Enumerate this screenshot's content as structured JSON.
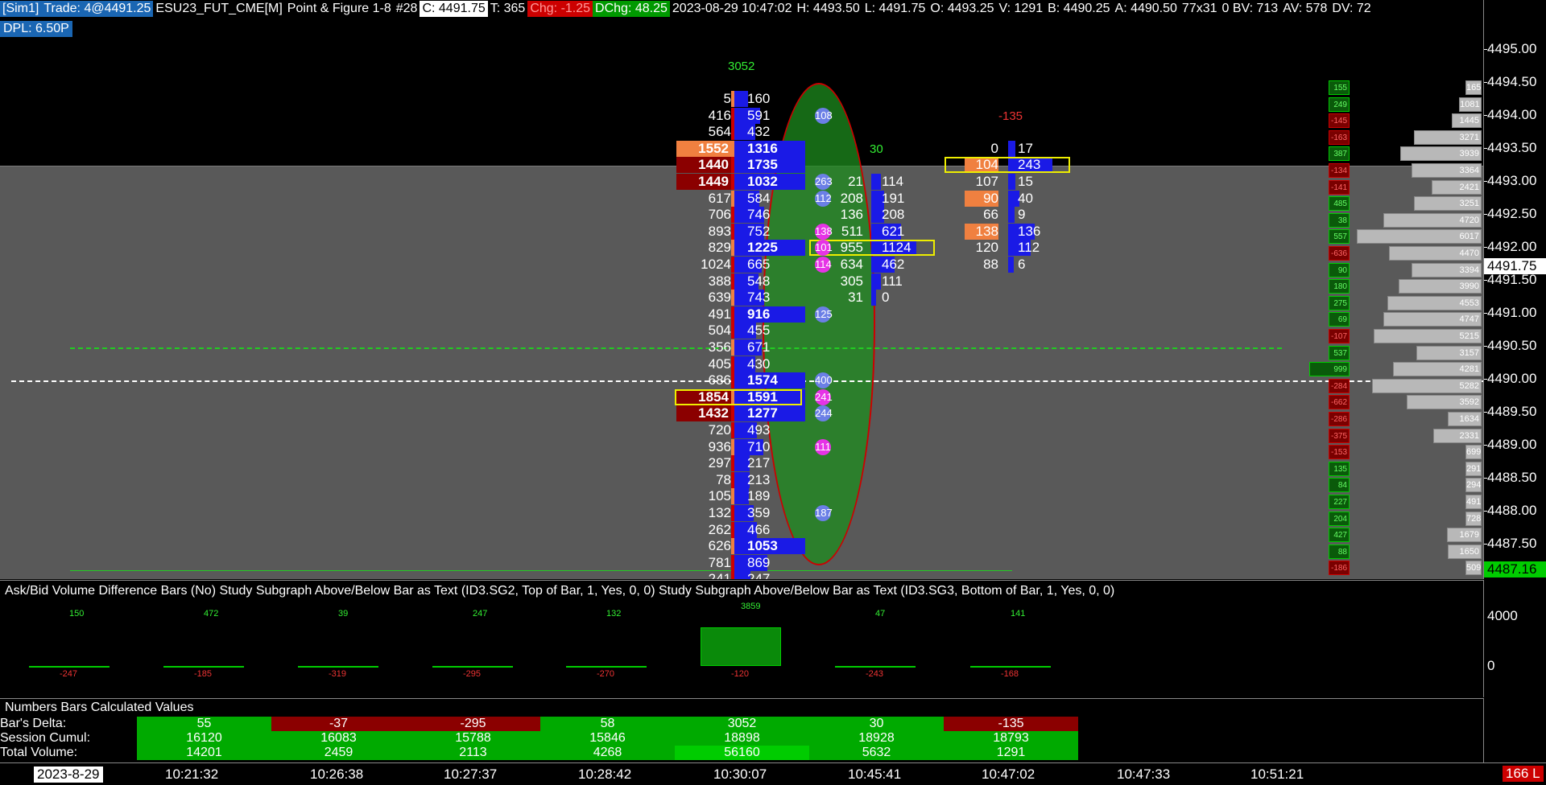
{
  "header": {
    "sim": "[Sim1]",
    "trade": "Trade: 4@4491.25",
    "symbol": "ESU23_FUT_CME[M]",
    "chart_type": "Point & Figure 1-8",
    "chart_num": "#28",
    "close": "C: 4491.75",
    "t": "T: 365",
    "chg": "Chg: -1.25",
    "dchg": "DChg: 48.25",
    "datetime": "2023-08-29 10:47:02",
    "high": "H: 4493.50",
    "low": "L: 4491.75",
    "open": "O: 4493.25",
    "vol": "V: 1291",
    "bid": "B: 4490.25",
    "ask": "A: 4490.50",
    "size": "77x31",
    "bv": "0 BV: 713",
    "av": "AV: 578",
    "dv": "DV: 72"
  },
  "dpl": "DPL: 6.50P",
  "price_axis": [
    "4495.00",
    "4494.50",
    "4494.00",
    "4493.50",
    "4493.00",
    "4492.50",
    "4492.00",
    "4491.50",
    "4491.00",
    "4490.50",
    "4490.00",
    "4489.50",
    "4489.00",
    "4488.50",
    "4488.00",
    "4487.50"
  ],
  "current_price": "4491.75",
  "ema_price": "4487.16",
  "bar_total_label": "3052",
  "bar2_label": "30",
  "bar3_label": "-135",
  "col1_bid": [
    "5",
    "416",
    "564",
    "1552",
    "1440",
    "1449",
    "617",
    "706",
    "893",
    "829",
    "1024",
    "388",
    "639",
    "491",
    "504",
    "356",
    "405",
    "686",
    "1854",
    "1432",
    "720",
    "936",
    "297",
    "78",
    "105",
    "132",
    "262",
    "626",
    "781",
    "241"
  ],
  "col1_ask": [
    "160",
    "591",
    "432",
    "1316",
    "1735",
    "1032",
    "584",
    "746",
    "752",
    "1225",
    "665",
    "548",
    "743",
    "916",
    "455",
    "671",
    "430",
    "1574",
    "1591",
    "1277",
    "493",
    "710",
    "217",
    "213",
    "189",
    "359",
    "466",
    "1053",
    "869",
    "247"
  ],
  "col2_bid": [
    "21",
    "208",
    "136",
    "511",
    "955",
    "634",
    "305",
    "31"
  ],
  "col2_ask": [
    "114",
    "191",
    "208",
    "621",
    "1124",
    "462",
    "111",
    "0"
  ],
  "col3_bid": [
    "0",
    "104",
    "107",
    "90",
    "66",
    "138",
    "120",
    "88"
  ],
  "col3_ask": [
    "17",
    "243",
    "15",
    "40",
    "9",
    "136",
    "112",
    "6"
  ],
  "bubbles": [
    "108",
    "263",
    "112",
    "138",
    "101",
    "114",
    "125",
    "400",
    "241",
    "244",
    "111",
    "187"
  ],
  "vp_values": [
    "165",
    "1081",
    "1445",
    "3271",
    "3939",
    "3364",
    "2421",
    "3251",
    "4720",
    "6017",
    "4470",
    "3394",
    "3990",
    "4553",
    "4747",
    "5215",
    "3157",
    "4281",
    "5282",
    "3592",
    "1634",
    "2331",
    "699",
    "291",
    "294",
    "491",
    "728",
    "1679",
    "1650",
    "509"
  ],
  "vp_delta": [
    "155",
    "249",
    "-145",
    "-163",
    "387",
    "-134",
    "-141",
    "485",
    "38",
    "557",
    "-636",
    "90",
    "180",
    "275",
    "69",
    "-107",
    "537",
    "999",
    "-284",
    "-662",
    "-286",
    "-375",
    "-153",
    "135",
    "84",
    "227",
    "204",
    "427",
    "88",
    "-186"
  ],
  "study": {
    "title": "Ask/Bid Volume Difference Bars   (No)  Study Subgraph Above/Below Bar as Text   (ID3.SG2, Top of Bar, 1, Yes, 0, 0)  Study Subgraph Above/Below Bar as Text   (ID3.SG3, Bottom of Bar, 1, Yes, 0, 0)",
    "axis": [
      "4000",
      "0"
    ],
    "top_vals": [
      "150",
      "472",
      "39",
      "247",
      "132",
      "3859",
      "47",
      "141"
    ],
    "bottom_vals": [
      "-247",
      "-185",
      "-319",
      "-295",
      "-270",
      "-120",
      "-243",
      "-168"
    ]
  },
  "numbers": {
    "title": "Numbers Bars Calculated Values",
    "row_labels": [
      "Bar's Delta:",
      "Session Cumul:",
      "Total Volume:"
    ],
    "bars_delta": [
      "55",
      "-37",
      "-295",
      "58",
      "3052",
      "30",
      "-135"
    ],
    "session_cumul": [
      "16120",
      "16083",
      "15788",
      "15846",
      "18898",
      "18928",
      "18793"
    ],
    "total_volume": [
      "14201",
      "2459",
      "2113",
      "4268",
      "56160",
      "5632",
      "1291"
    ]
  },
  "time_axis": [
    "2023-8-29",
    "10:21:32",
    "10:26:38",
    "10:27:37",
    "10:28:42",
    "10:30:07",
    "10:45:41",
    "10:47:02",
    "10:47:33",
    "10:51:21"
  ],
  "bottom_badge": "166 L",
  "colors": {
    "bid_strong": "#8b0000",
    "ask_strong": "#1a1ae6",
    "delta_pos": "#00aa00",
    "delta_neg": "#aa0000"
  }
}
